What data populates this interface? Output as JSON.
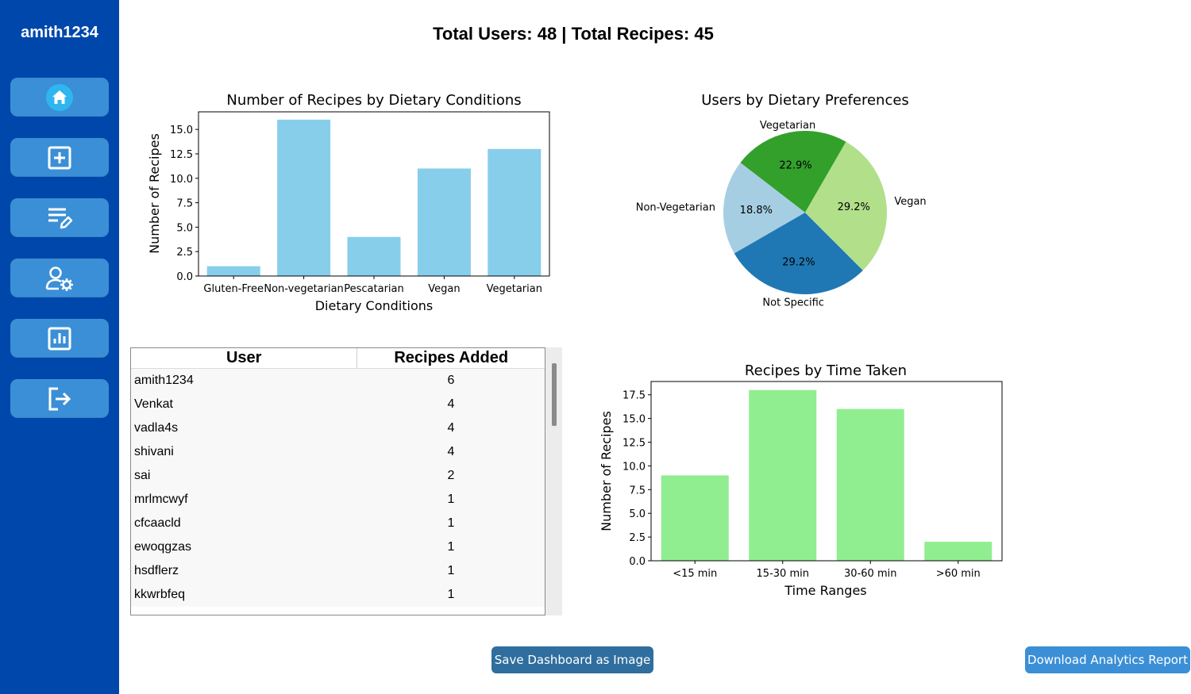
{
  "sidebar": {
    "username": "amith1234",
    "items": [
      {
        "icon": "home-icon"
      },
      {
        "icon": "add-recipe-icon"
      },
      {
        "icon": "edit-list-icon"
      },
      {
        "icon": "user-settings-icon"
      },
      {
        "icon": "analytics-icon"
      },
      {
        "icon": "logout-icon"
      }
    ]
  },
  "header": {
    "stats": "Total Users: 48 | Total Recipes: 45"
  },
  "colors": {
    "sidebar": "#0047ab",
    "nav_button": "#3b8fd6",
    "bar_blue": "#87ceeb",
    "bar_green": "#90ee90",
    "pie": [
      "#33a02c",
      "#a6cee3",
      "#1f78b4",
      "#b2df8a"
    ]
  },
  "chart_data": [
    {
      "type": "bar",
      "title": "Number of Recipes by Dietary Conditions",
      "xlabel": "Dietary Conditions",
      "ylabel": "Number of Recipes",
      "categories": [
        "Gluten-Free",
        "Non-vegetarian",
        "Pescatarian",
        "Vegan",
        "Vegetarian"
      ],
      "values": [
        1,
        16,
        4,
        11,
        13
      ],
      "ylim": [
        0,
        16.8
      ],
      "yticks": [
        "0.0",
        "2.5",
        "5.0",
        "7.5",
        "10.0",
        "12.5",
        "15.0"
      ]
    },
    {
      "type": "pie",
      "title": "Users by Dietary Preferences",
      "slices": [
        {
          "label": "Vegetarian",
          "pct": "22.9%",
          "value": 22.9
        },
        {
          "label": "Non-Vegetarian",
          "pct": "18.8%",
          "value": 18.8
        },
        {
          "label": "Not Specific",
          "pct": "29.2%",
          "value": 29.2
        },
        {
          "label": "Vegan",
          "pct": "29.2%",
          "value": 29.2
        }
      ]
    },
    {
      "type": "bar",
      "title": "Recipes by Time Taken",
      "xlabel": "Time Ranges",
      "ylabel": "Number of Recipes",
      "categories": [
        "<15 min",
        "15-30 min",
        "30-60 min",
        ">60 min"
      ],
      "values": [
        9,
        18,
        16,
        2
      ],
      "ylim": [
        0,
        18.9
      ],
      "yticks": [
        "0.0",
        "2.5",
        "5.0",
        "7.5",
        "10.0",
        "12.5",
        "15.0",
        "17.5"
      ]
    }
  ],
  "table": {
    "headers": [
      "User",
      "Recipes Added"
    ],
    "rows": [
      [
        "amith1234",
        "6"
      ],
      [
        "Venkat",
        "4"
      ],
      [
        "vadla4s",
        "4"
      ],
      [
        "shivani",
        "4"
      ],
      [
        "sai",
        "2"
      ],
      [
        "mrlmcwyf",
        "1"
      ],
      [
        "cfcaacld",
        "1"
      ],
      [
        "ewoqgzas",
        "1"
      ],
      [
        "hsdflerz",
        "1"
      ],
      [
        "kkwrbfeq",
        "1"
      ]
    ]
  },
  "buttons": {
    "save": "Save Dashboard as Image",
    "download": "Download Analytics Report"
  }
}
